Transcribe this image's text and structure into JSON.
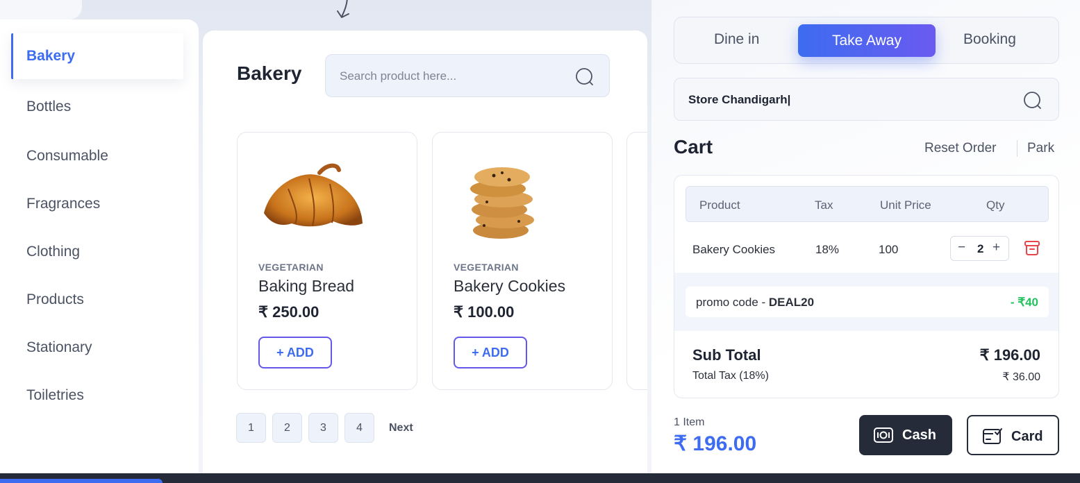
{
  "categories": {
    "active": "Bakery",
    "items": [
      "Bottles",
      "Consumable",
      "Fragrances",
      "Clothing",
      "Products",
      "Stationary",
      "Toiletries"
    ]
  },
  "main": {
    "title": "Bakery",
    "search_placeholder": "Search product here..."
  },
  "products": [
    {
      "tag": "VEGETARIAN",
      "name": "Baking Bread",
      "price": "₹ 250.00",
      "add_label": "+ ADD"
    },
    {
      "tag": "VEGETARIAN",
      "name": "Bakery Cookies",
      "price": "₹ 100.00",
      "add_label": "+ ADD"
    }
  ],
  "pagination": {
    "pages": [
      "1",
      "2",
      "3",
      "4"
    ],
    "next": "Next"
  },
  "order_modes": {
    "dine_in": "Dine in",
    "take_away": "Take Away",
    "booking": "Booking",
    "active": "Take Away"
  },
  "store": {
    "value": "Store Chandigarh|"
  },
  "cart": {
    "title": "Cart",
    "reset": "Reset Order",
    "park": "Park",
    "columns": {
      "product": "Product",
      "tax": "Tax",
      "unit_price": "Unit Price",
      "qty": "Qty"
    },
    "rows": [
      {
        "product": "Bakery Cookies",
        "tax": "18%",
        "unit_price": "100",
        "qty": "2"
      }
    ],
    "qty_minus": "−",
    "qty_plus": "+",
    "promo": {
      "label": "promo code - ",
      "code": "DEAL20",
      "discount": "- ₹40"
    },
    "subtotal_label": "Sub Total",
    "subtotal_value": "₹ 196.00",
    "tax_label": "Total Tax (18%)",
    "tax_value": "₹ 36.00"
  },
  "footer": {
    "items_count": "1 Item",
    "total": "₹ 196.00",
    "cash_label": "Cash",
    "card_label": "Card"
  },
  "colors": {
    "accent": "#3d6cf0",
    "accent2": "#6a5af0",
    "dark": "#262b3a",
    "success": "#22c35e",
    "danger": "#e8454a"
  }
}
